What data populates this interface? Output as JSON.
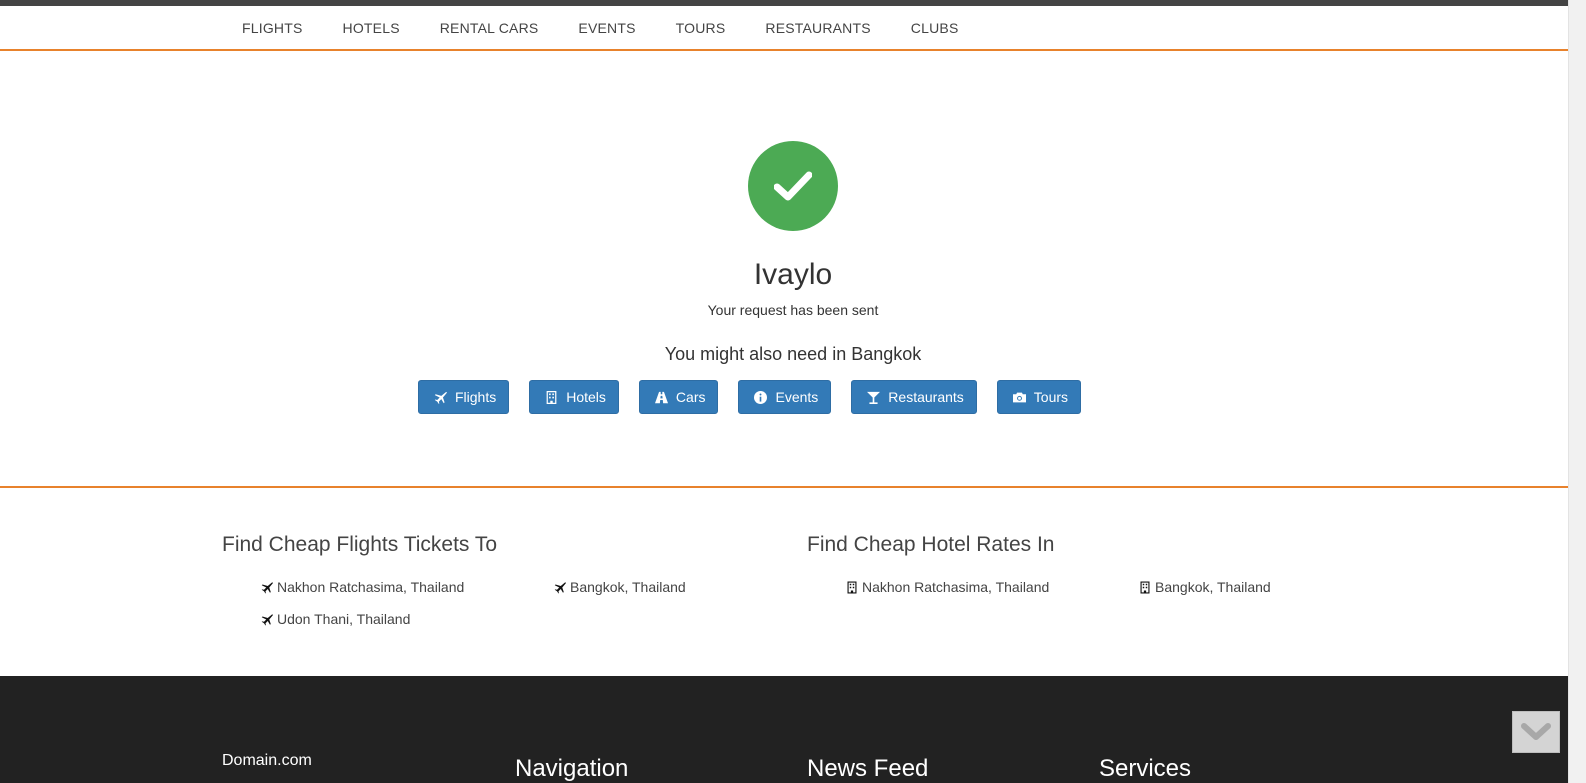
{
  "nav": {
    "items": [
      "FLIGHTS",
      "HOTELS",
      "RENTAL CARS",
      "EVENTS",
      "TOURS",
      "RESTAURANTS",
      "CLUBS"
    ]
  },
  "hero": {
    "status_icon": "check-icon",
    "status_color": "#4caa54",
    "name": "Ivaylo",
    "message": "Your request has been sent",
    "also_need": "You might also need in Bangkok",
    "buttons": [
      {
        "label": "Flights",
        "icon": "plane-icon"
      },
      {
        "label": "Hotels",
        "icon": "building-icon"
      },
      {
        "label": "Cars",
        "icon": "road-icon"
      },
      {
        "label": "Events",
        "icon": "info-icon"
      },
      {
        "label": "Restaurants",
        "icon": "cocktail-icon"
      },
      {
        "label": "Tours",
        "icon": "camera-icon"
      }
    ],
    "button_color": "#337ab7"
  },
  "flights": {
    "title": "Find Cheap Flights Tickets To",
    "items": [
      "Nakhon Ratchasima, Thailand",
      "Bangkok, Thailand",
      "Udon Thani, Thailand"
    ]
  },
  "hotels": {
    "title": "Find Cheap Hotel Rates In",
    "items": [
      "Nakhon Ratchasima, Thailand",
      "Bangkok, Thailand"
    ]
  },
  "footer": {
    "domain": "Domain.com",
    "navigation": "Navigation",
    "news_feed": "News Feed",
    "services": "Services"
  },
  "accent_color": "#e8822c"
}
